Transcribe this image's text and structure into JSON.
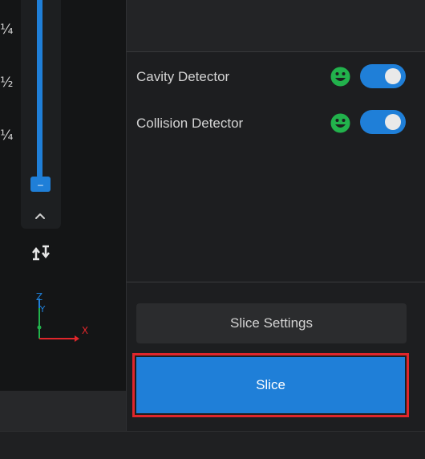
{
  "viewport": {
    "ruler_fractions": [
      "¼",
      "½",
      "¼"
    ],
    "slider_thumb_glyph": "–",
    "axis_labels": {
      "z": "Z",
      "y": "Y",
      "x": "X"
    }
  },
  "detectors": [
    {
      "label": "Cavity Detector",
      "status_icon": "smiley-green-icon",
      "enabled": true
    },
    {
      "label": "Collision Detector",
      "status_icon": "smiley-green-icon",
      "enabled": true
    }
  ],
  "actions": {
    "settings_label": "Slice Settings",
    "slice_label": "Slice"
  },
  "colors": {
    "accent": "#1f7fd8",
    "status_ok": "#22b24c",
    "highlight": "#e0262b",
    "axis_x": "#e0262b",
    "axis_y": "#22b24c",
    "axis_z": "#1f7fd8"
  }
}
